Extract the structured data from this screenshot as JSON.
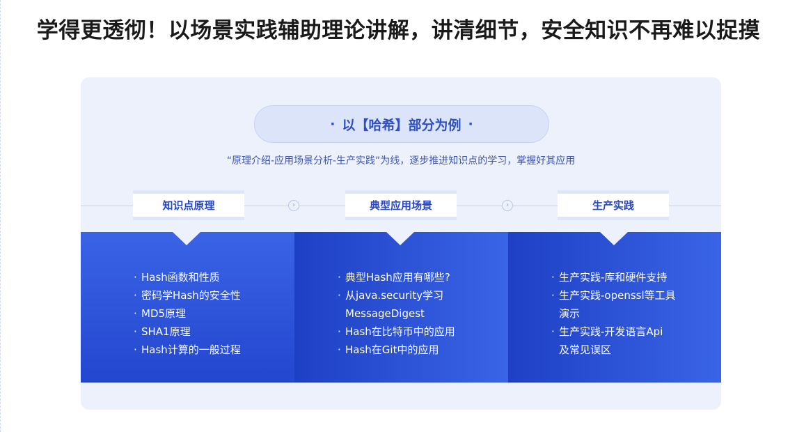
{
  "headline": "学得更透彻！以场景实践辅助理论讲解，讲清细节，安全知识不再难以捉摸",
  "example_pill": {
    "dot_left": "·",
    "label": "以【哈希】部分为例",
    "dot_right": "·"
  },
  "subtitle": "“原理介绍-应用场景分析-生产实践”为线，逐步推进知识点的学习，掌握好其应用",
  "icons": {
    "step_arrow": "chevron-right-circle"
  },
  "colors": {
    "card_bg": "#edf1fb",
    "accent": "#2446c8",
    "panel_blue": "#3a63e6"
  },
  "stages": [
    {
      "title": "知识点原理",
      "items": [
        {
          "bullet": "·",
          "lines": [
            "Hash函数和性质"
          ]
        },
        {
          "bullet": "·",
          "lines": [
            "密码学Hash的安全性"
          ]
        },
        {
          "bullet": "·",
          "lines": [
            "MD5原理"
          ]
        },
        {
          "bullet": "·",
          "lines": [
            "SHA1原理"
          ]
        },
        {
          "bullet": "·",
          "lines": [
            "Hash计算的一般过程"
          ]
        }
      ]
    },
    {
      "title": "典型应用场景",
      "items": [
        {
          "bullet": "·",
          "lines": [
            "典型Hash应用有哪些?"
          ]
        },
        {
          "bullet": "·",
          "lines": [
            "从java.security学习",
            "MessageDigest"
          ]
        },
        {
          "bullet": "·",
          "lines": [
            "Hash在比特币中的应用"
          ]
        },
        {
          "bullet": "·",
          "lines": [
            "Hash在Git中的应用"
          ]
        }
      ]
    },
    {
      "title": "生产实践",
      "items": [
        {
          "bullet": "·",
          "lines": [
            "生产实践-库和硬件支持"
          ]
        },
        {
          "bullet": "·",
          "lines": [
            "生产实践-openssl等工具",
            "演示"
          ]
        },
        {
          "bullet": "·",
          "lines": [
            "生产实践-开发语言Api",
            "及常见误区"
          ]
        }
      ]
    }
  ]
}
